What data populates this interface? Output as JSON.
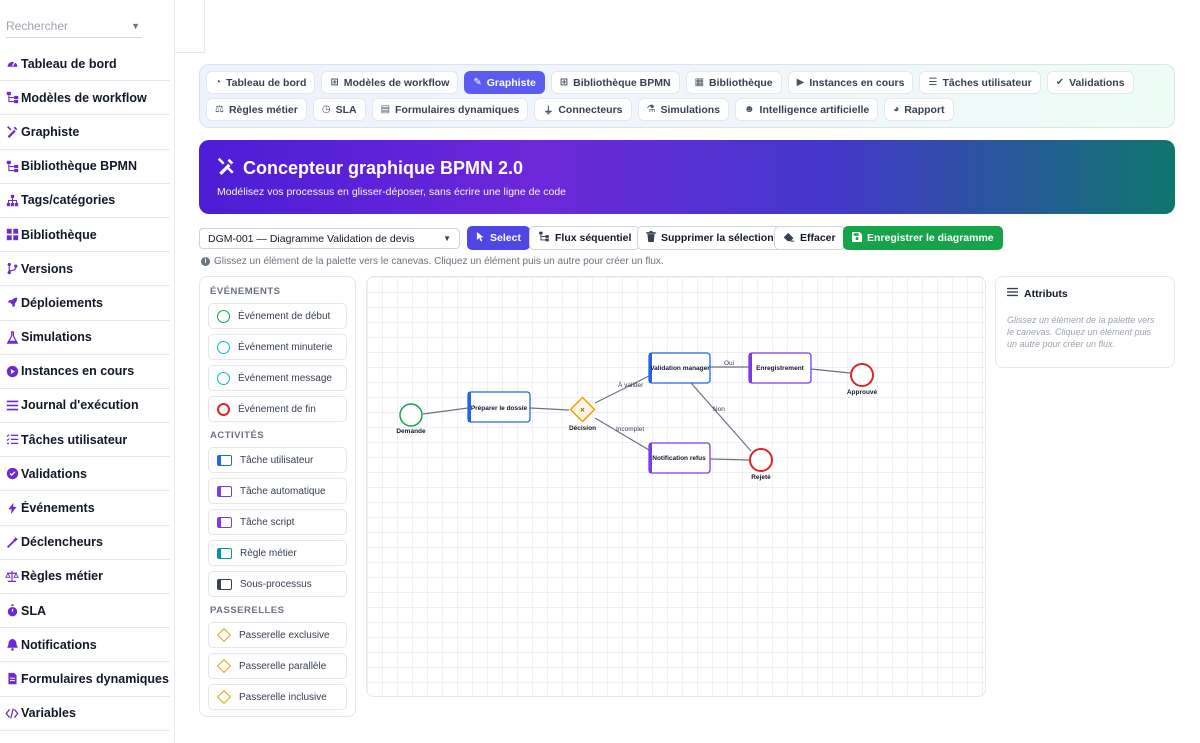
{
  "search": {
    "placeholder": "Rechercher"
  },
  "sidebar": {
    "items": [
      {
        "label": "Tableau de bord",
        "icon": "gauge-icon"
      },
      {
        "label": "Modèles de workflow",
        "icon": "sitemap-icon"
      },
      {
        "label": "Graphiste",
        "icon": "pen-ruler-icon"
      },
      {
        "label": "Bibliothèque BPMN",
        "icon": "sitemap-icon"
      },
      {
        "label": "Tags/catégories",
        "icon": "hierarchy-icon"
      },
      {
        "label": "Bibliothèque",
        "icon": "grid-icon"
      },
      {
        "label": "Versions",
        "icon": "branch-icon"
      },
      {
        "label": "Déploiements",
        "icon": "rocket-icon"
      },
      {
        "label": "Simulations",
        "icon": "flask-icon"
      },
      {
        "label": "Instances en cours",
        "icon": "play-circle-icon"
      },
      {
        "label": "Journal d'exécution",
        "icon": "list-icon"
      },
      {
        "label": "Tâches utilisateur",
        "icon": "list-check-icon"
      },
      {
        "label": "Validations",
        "icon": "check-circle-icon"
      },
      {
        "label": "Événements",
        "icon": "bolt-icon"
      },
      {
        "label": "Déclencheurs",
        "icon": "wand-icon"
      },
      {
        "label": "Règles métier",
        "icon": "scale-icon"
      },
      {
        "label": "SLA",
        "icon": "stopwatch-icon"
      },
      {
        "label": "Notifications",
        "icon": "bell-icon"
      },
      {
        "label": "Formulaires dynamiques",
        "icon": "form-icon"
      },
      {
        "label": "Variables",
        "icon": "code-icon"
      }
    ]
  },
  "tabs": {
    "row1": [
      {
        "label": "Tableau de bord",
        "icon": "gauge-icon"
      },
      {
        "label": "Modèles de workflow",
        "icon": "sitemap-icon"
      },
      {
        "label": "Graphiste",
        "icon": "pen-ruler-icon",
        "active": true
      },
      {
        "label": "Bibliothèque BPMN",
        "icon": "sitemap-icon"
      },
      {
        "label": "Bibliothèque",
        "icon": "grid-icon"
      },
      {
        "label": "Instances en cours",
        "icon": "play-circle-icon"
      },
      {
        "label": "Tâches utilisateur",
        "icon": "list-check-icon"
      },
      {
        "label": "Validations",
        "icon": "check-circle-icon"
      }
    ],
    "row2": [
      {
        "label": "Règles métier",
        "icon": "scale-icon"
      },
      {
        "label": "SLA",
        "icon": "stopwatch-icon"
      },
      {
        "label": "Formulaires dynamiques",
        "icon": "form-icon"
      },
      {
        "label": "Connecteurs",
        "icon": "plug-icon"
      },
      {
        "label": "Simulations",
        "icon": "flask-icon"
      },
      {
        "label": "Intelligence artificielle",
        "icon": "robot-icon"
      },
      {
        "label": "Rapport",
        "icon": "pie-chart-icon"
      }
    ]
  },
  "banner": {
    "title": "Concepteur graphique BPMN 2.0",
    "subtitle": "Modélisez vos processus en glisser-déposer, sans écrire une ligne de code"
  },
  "toolbar": {
    "diagram_select": "DGM-001 — Diagramme Validation de devis",
    "select_label": "Select",
    "flow_label": "Flux séquentiel",
    "delete_label": "Supprimer la sélection",
    "clear_label": "Effacer",
    "save_label": "Enregistrer le diagramme"
  },
  "hint": "Glissez un élément de la palette vers le canevas. Cliquez un élément puis un autre pour créer un flux.",
  "palette": {
    "events_title": "ÉVÉNEMENTS",
    "events": [
      {
        "label": "Événement de début",
        "color": "#16a34a"
      },
      {
        "label": "Événement minuterie",
        "color": "#06b6d4"
      },
      {
        "label": "Événement message",
        "color": "#06b6d4"
      },
      {
        "label": "Événement de fin",
        "color": "#dc2626"
      }
    ],
    "activities_title": "ACTIVITÉS",
    "activities": [
      {
        "label": "Tâche utilisateur",
        "color": "#2563eb"
      },
      {
        "label": "Tâche automatique",
        "color": "#7c3aed"
      },
      {
        "label": "Tâche script",
        "color": "#7c3aed"
      },
      {
        "label": "Règle métier",
        "color": "#0891b2"
      },
      {
        "label": "Sous-processus",
        "color": "#374151"
      }
    ],
    "gateways_title": "PASSERELLES",
    "gateways": [
      {
        "label": "Passerelle exclusive"
      },
      {
        "label": "Passerelle parallèle"
      },
      {
        "label": "Passerelle inclusive"
      }
    ]
  },
  "diagram": {
    "start_label": "Demande",
    "task_prepare": "Préparer le dossie",
    "gateway_label": "Décision",
    "gateway_symbol": "×",
    "task_validation": "Validation manager",
    "task_register": "Enregistrement",
    "task_notify": "Notification refus",
    "end_approved": "Approuvé",
    "end_rejected": "Rejeté",
    "flow_to_validate": "À valider",
    "flow_incomplete": "Incomplet",
    "flow_yes": "Oui",
    "flow_no": "Non"
  },
  "attributes": {
    "title": "Attributs",
    "empty": "Glissez un élément de la palette vers le canevas. Cliquez un élément puis un autre pour créer un flux."
  },
  "colors": {
    "accent": "#5b5bf0",
    "success": "#16a34a",
    "start_event": "#16a34a",
    "end_event": "#dc2626",
    "gateway": "#f59e0b",
    "user_task": "#2563eb",
    "auto_task": "#7c3aed"
  }
}
